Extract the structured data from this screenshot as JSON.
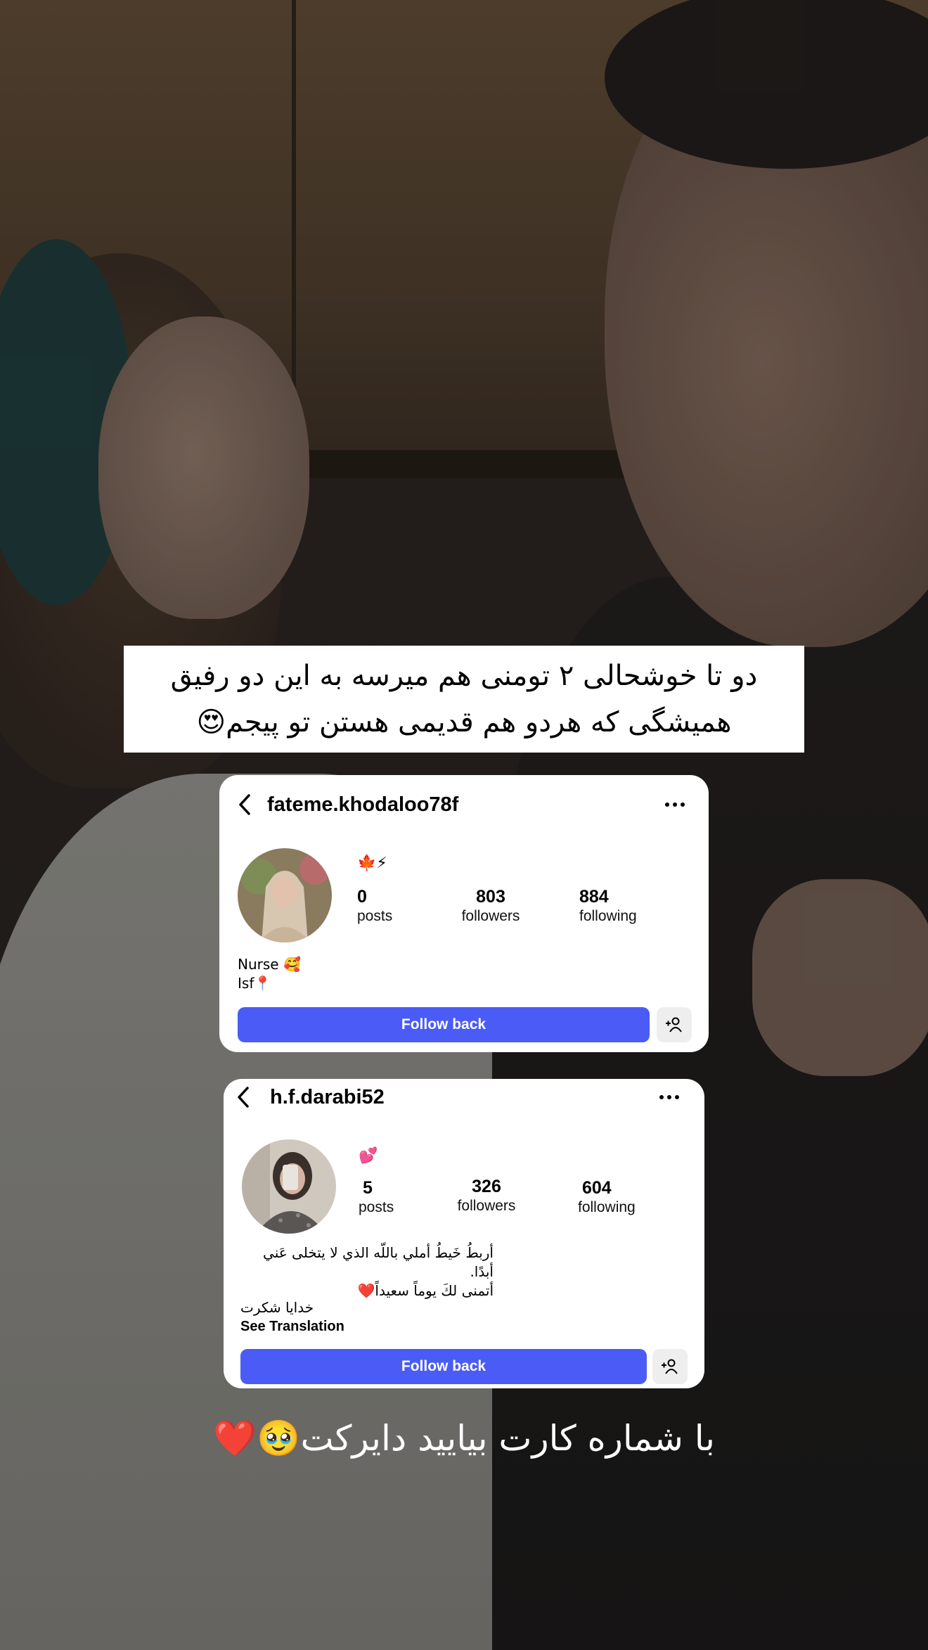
{
  "caption": {
    "line1": "دو تا خوشحالی ۲ تومنی هم میرسه به این دو رفیق",
    "line2": "همیشگی که هردو هم قدیمی هستن تو پیجم😍"
  },
  "profiles": [
    {
      "username": "fateme.khodaloo78f",
      "emojis": "🍁⚡",
      "posts": "0",
      "posts_label": "posts",
      "followers": "803",
      "followers_label": "followers",
      "following": "884",
      "following_label": "following",
      "bio_line1": "Nurse 🥰",
      "bio_line2": "Isf📍",
      "follow_button": "Follow back"
    },
    {
      "username": "h.f.darabi52",
      "emojis": "💕",
      "posts": "5",
      "posts_label": "posts",
      "followers": "326",
      "followers_label": "followers",
      "following": "604",
      "following_label": "following",
      "bio_line1": "أربطُ خَيطُ أملي باللّه الذي لا يتخلى عَني أبدًا.",
      "bio_line2": "أتمنى لكَ يوماً سعيداً❤️",
      "bio_line3": "خدایا شکرت",
      "see_translation": "See Translation",
      "follow_button": "Follow back"
    }
  ],
  "bottom_caption": "با شماره کارت بیایید دایرکت🥹❤️",
  "colors": {
    "follow_button": "#4a5cf5",
    "caption_bg": "#ffffff"
  }
}
